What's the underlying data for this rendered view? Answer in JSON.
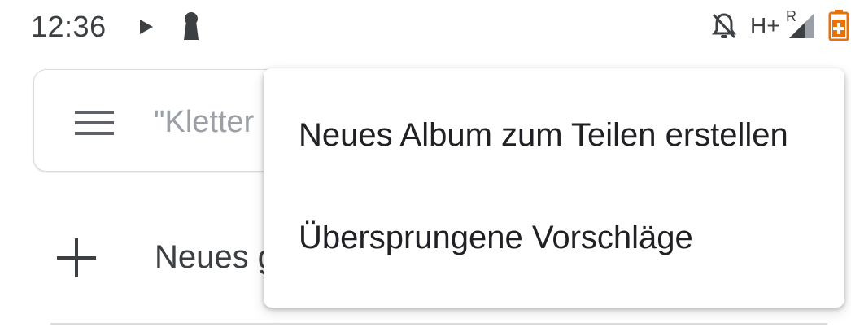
{
  "status_bar": {
    "time": "12:36",
    "icons": [
      "play-icon",
      "keyhole-icon",
      "bell-off-icon",
      "network-hplus-icon",
      "signal-roaming-icon",
      "battery-charging-icon"
    ],
    "network_label": "H+",
    "roaming_label": "R",
    "battery_color": "#e8710a"
  },
  "search": {
    "placeholder": "\"Kletter"
  },
  "new_group": {
    "label": "Neues g"
  },
  "popup_menu": {
    "items": [
      {
        "label": "Neues Album zum Teilen erstellen"
      },
      {
        "label": "Übersprungene Vorschläge"
      }
    ]
  }
}
